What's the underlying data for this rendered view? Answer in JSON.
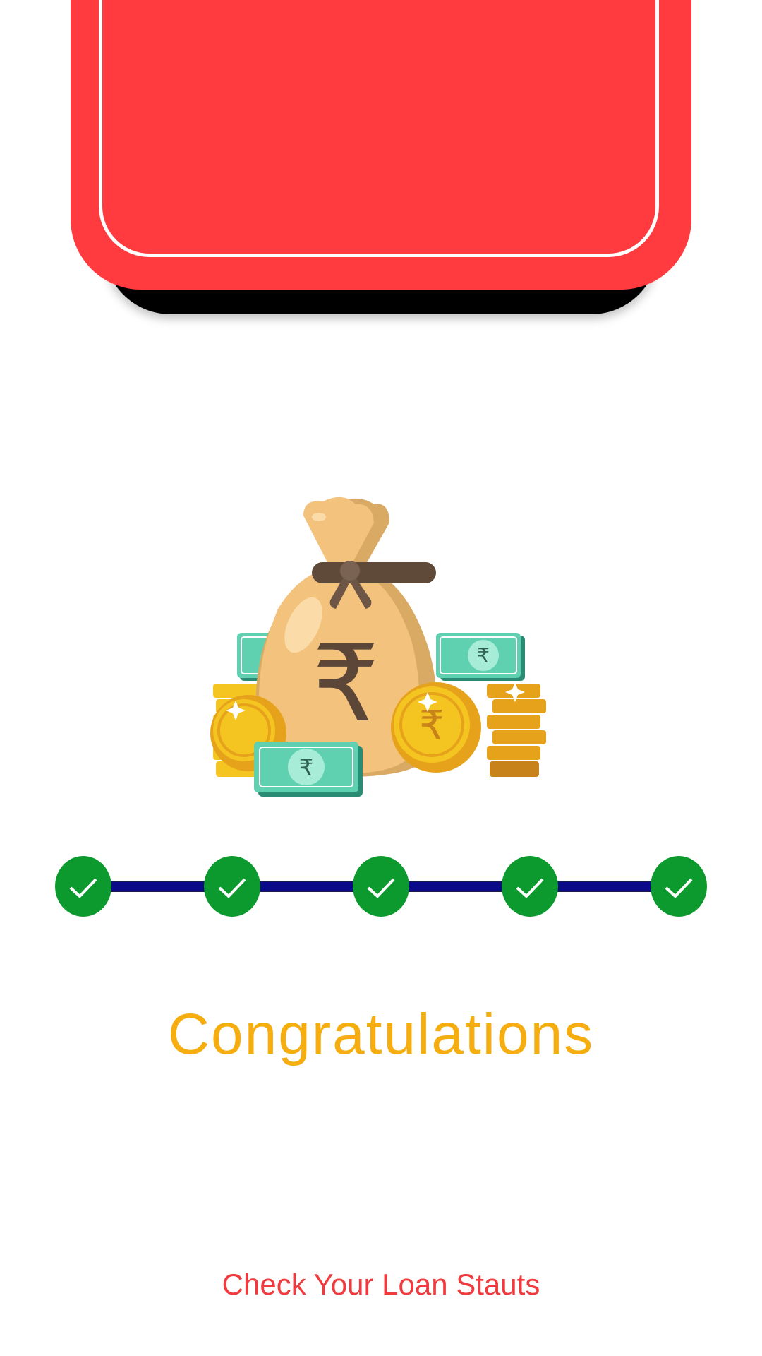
{
  "header": {
    "card_color": "#ff3b3f",
    "shadow_color": "#000000"
  },
  "illustration": {
    "icon": "money-bag-rupee-icon",
    "symbol": "₹"
  },
  "stepper": {
    "line_color": "#0a0a8a",
    "step_color": "#0c9a2e",
    "steps": [
      {
        "status": "completed",
        "icon": "check-icon"
      },
      {
        "status": "completed",
        "icon": "check-icon"
      },
      {
        "status": "completed",
        "icon": "check-icon"
      },
      {
        "status": "completed",
        "icon": "check-icon"
      },
      {
        "status": "completed",
        "icon": "check-icon"
      }
    ]
  },
  "main": {
    "title": "Congratulations",
    "title_color": "#f5ad0f",
    "link_label": "Check Your Loan Stauts",
    "link_color": "#ef3b3e"
  }
}
